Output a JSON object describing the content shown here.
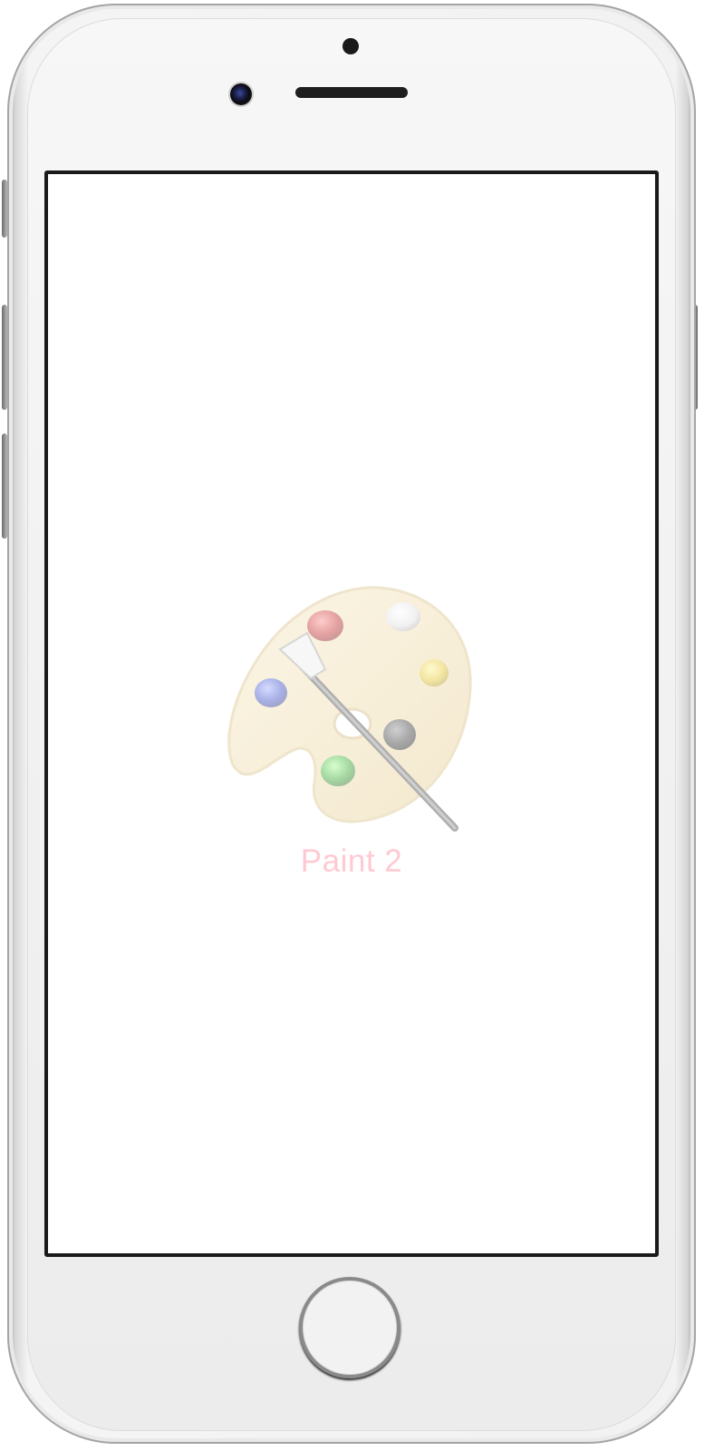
{
  "device": {
    "model_icon": "iphone-frame",
    "screen_background": "#ffffff"
  },
  "launch_screen": {
    "app_name": "Paint 2",
    "app_icon": "paint-palette-icon",
    "app_name_color": "#ff8a9c"
  }
}
